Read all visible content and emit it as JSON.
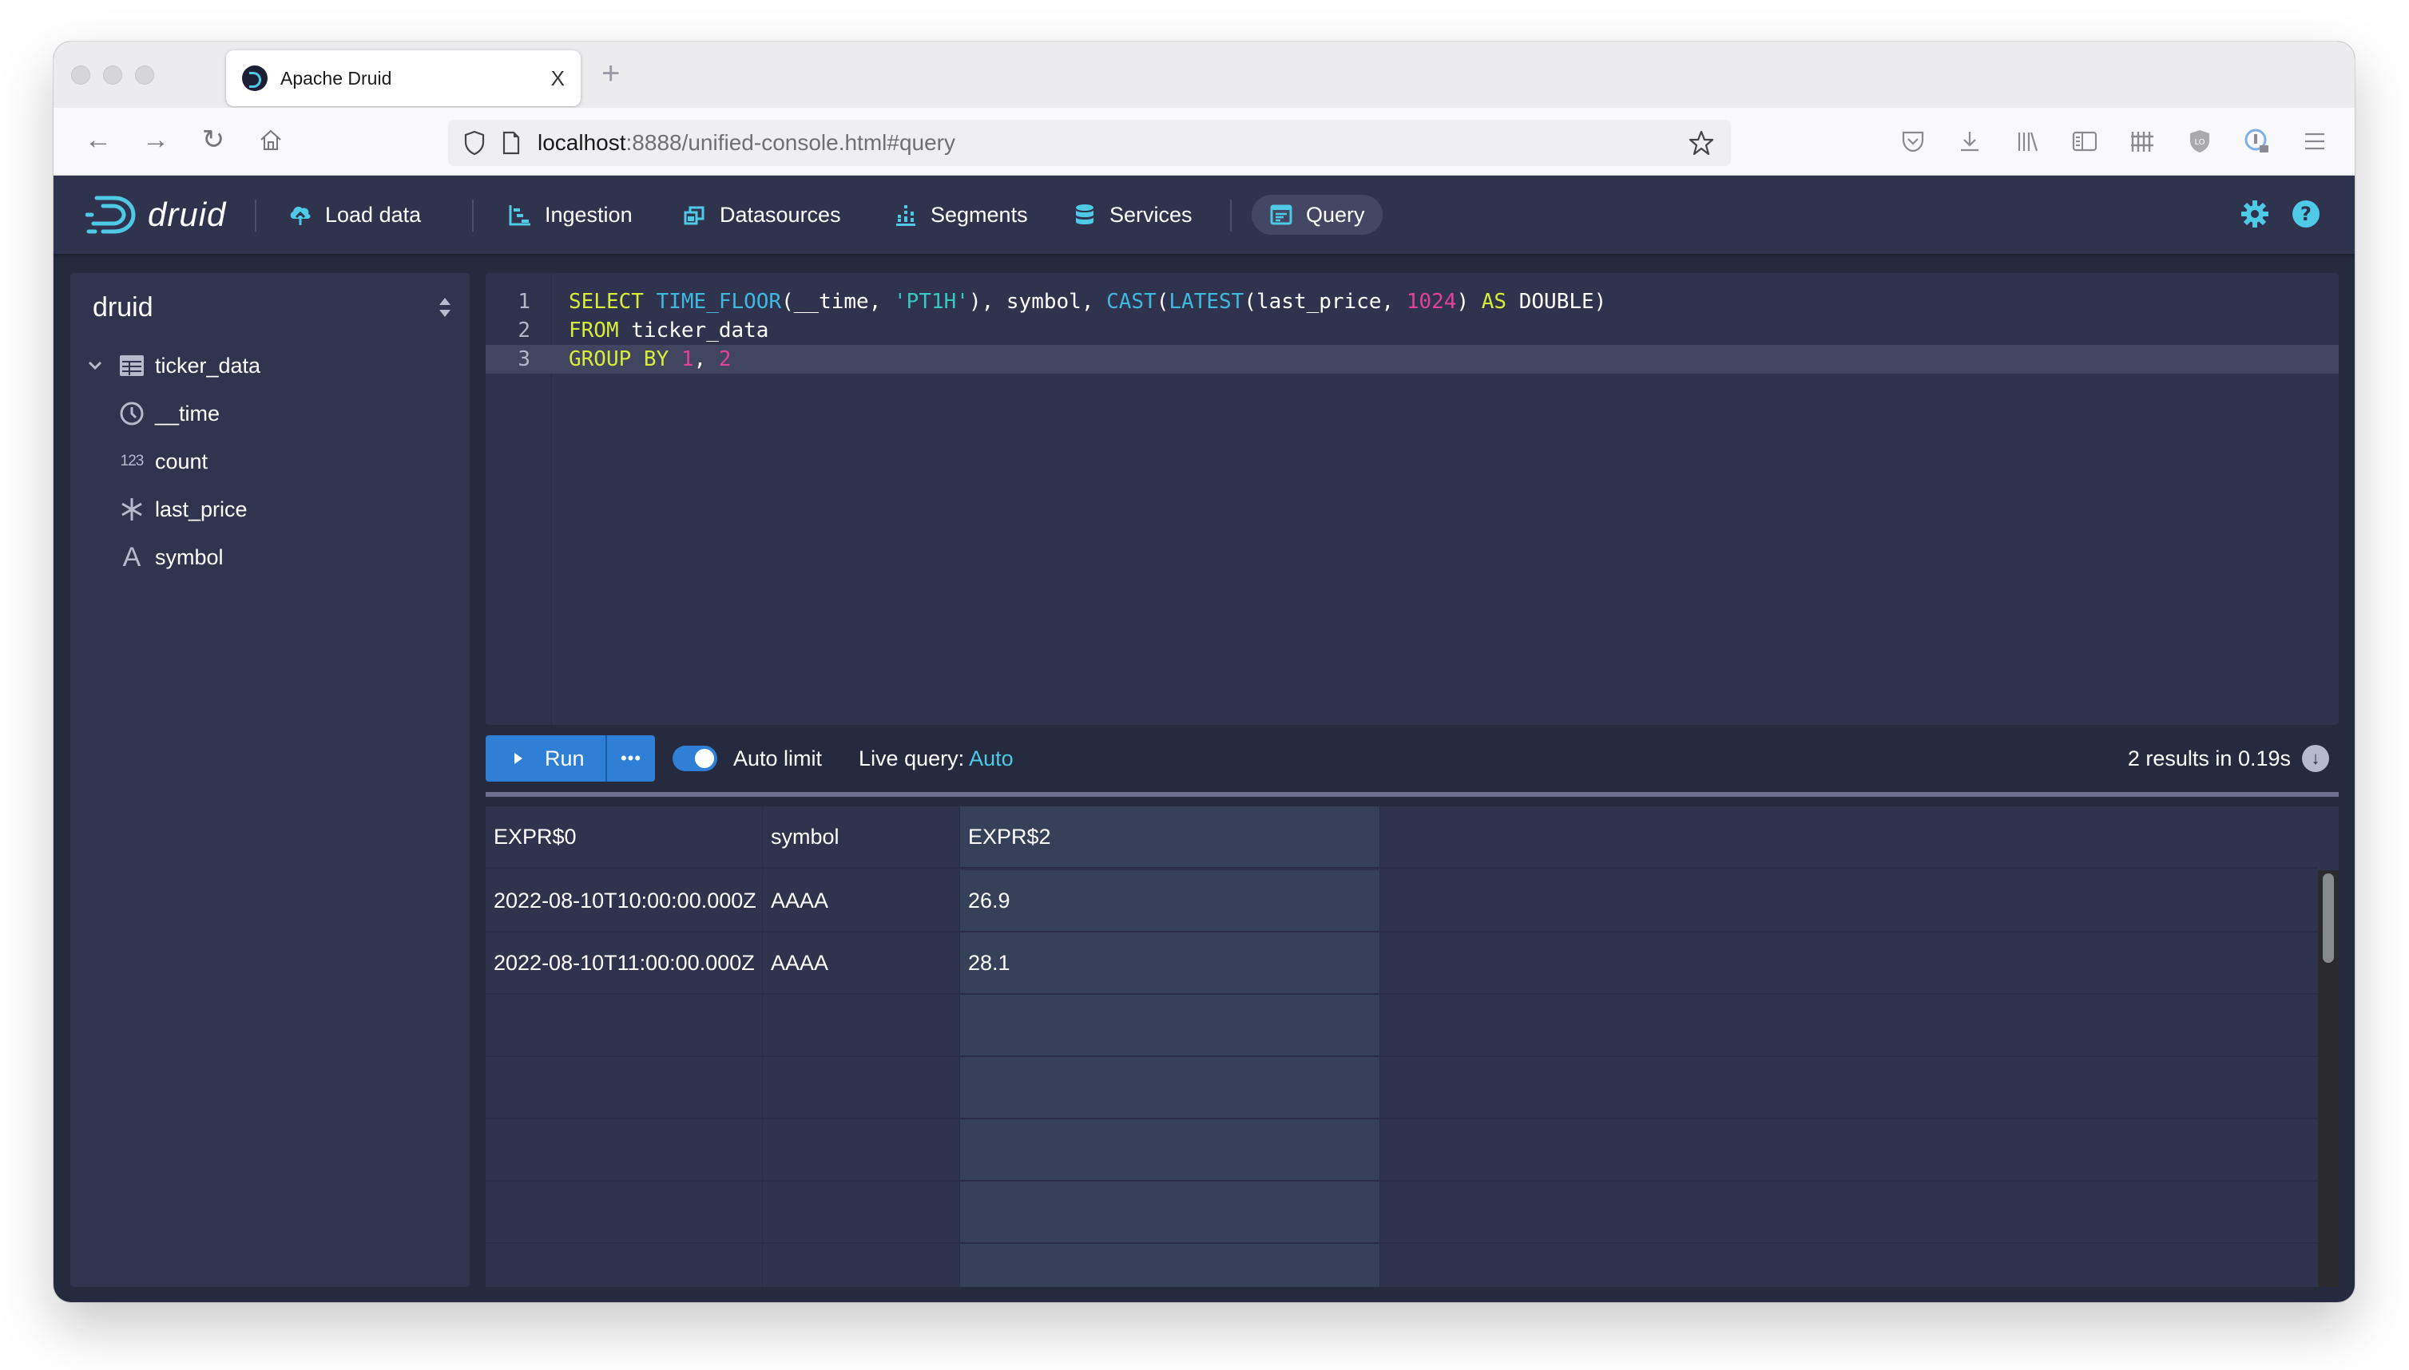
{
  "browser": {
    "tab_title": "Apache Druid",
    "tab_close": "X",
    "new_tab": "+",
    "url_host": "localhost",
    "url_rest": ":8888/unified-console.html#query"
  },
  "nav": {
    "logo_text": "druid",
    "items": [
      {
        "label": "Load data",
        "icon": "cloud-upload-icon"
      },
      {
        "label": "Ingestion",
        "icon": "gantt-chart-icon"
      },
      {
        "label": "Datasources",
        "icon": "multi-select-icon"
      },
      {
        "label": "Segments",
        "icon": "segments-icon"
      },
      {
        "label": "Services",
        "icon": "database-icon"
      },
      {
        "label": "Query",
        "icon": "application-icon",
        "active": true
      }
    ],
    "accent": "#4ec9e6"
  },
  "sidebar": {
    "title": "druid",
    "table": "ticker_data",
    "columns": [
      {
        "name": "__time",
        "type": "clock-icon"
      },
      {
        "name": "count",
        "type": "numeric-icon",
        "glyph": "123"
      },
      {
        "name": "last_price",
        "type": "asterisk-icon",
        "glyph": "✳"
      },
      {
        "name": "symbol",
        "type": "string-icon",
        "glyph": "A"
      }
    ]
  },
  "editor": {
    "line_numbers": [
      "1",
      "2",
      "3"
    ]
  },
  "runbar": {
    "run_label": "Run",
    "more_label": "•••",
    "auto_limit_label": "Auto limit",
    "auto_limit_on": true,
    "live_query_label": "Live query:",
    "live_query_value": "Auto",
    "results_text": "2 results in 0.19s"
  },
  "table": {
    "headers": [
      "EXPR$0",
      "symbol",
      "EXPR$2"
    ],
    "rows": [
      [
        "2022-08-10T10:00:00.000Z",
        "AAAA",
        "26.9"
      ],
      [
        "2022-08-10T11:00:00.000Z",
        "AAAA",
        "28.1"
      ]
    ]
  }
}
